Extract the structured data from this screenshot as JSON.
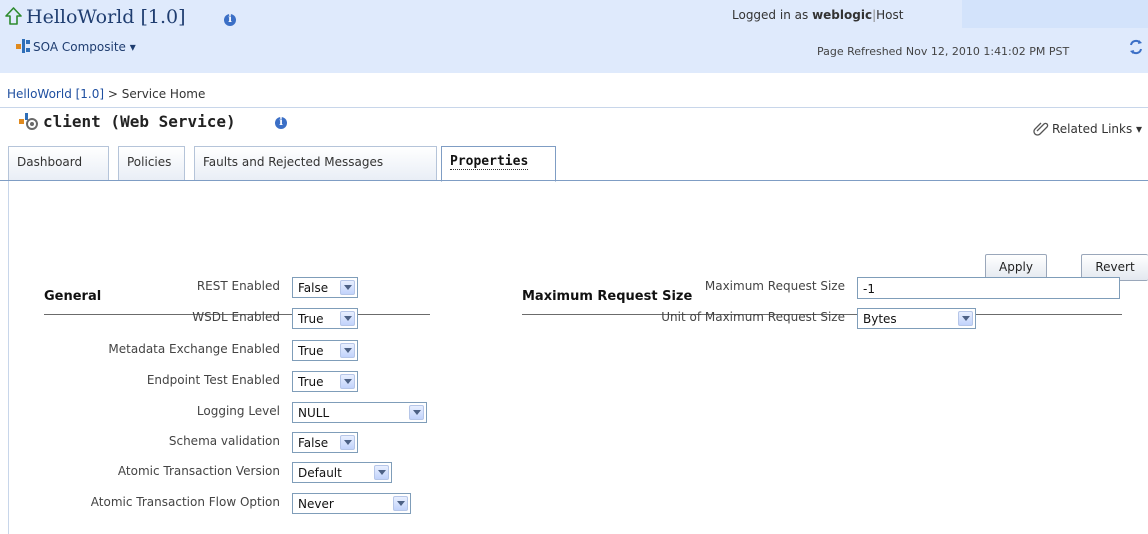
{
  "header": {
    "title": "HelloWorld [1.0]",
    "composite_menu": "SOA Composite ▾",
    "logged_in_prefix": "Logged in as",
    "user": "weblogic",
    "separator": "|",
    "host": "Host",
    "page_refreshed": "Page Refreshed Nov 12, 2010 1:41:02 PM PST"
  },
  "breadcrumb": {
    "link": "HelloWorld [1.0]",
    "separator": " > ",
    "current": "Service Home"
  },
  "service": {
    "title": "client (Web Service)",
    "related_links": "Related Links ▾"
  },
  "tabs": [
    {
      "label": "Dashboard",
      "active": false
    },
    {
      "label": "Policies",
      "active": false
    },
    {
      "label": "Faults and Rejected Messages",
      "active": false
    },
    {
      "label": "Properties",
      "active": true
    }
  ],
  "buttons": {
    "apply": "Apply",
    "revert": "Revert"
  },
  "general": {
    "title": "General",
    "rows": [
      {
        "label": "REST Enabled",
        "value": "False"
      },
      {
        "label": "WSDL Enabled",
        "value": "True"
      },
      {
        "label": "Metadata Exchange Enabled",
        "value": "True"
      },
      {
        "label": "Endpoint Test Enabled",
        "value": "True"
      },
      {
        "label": "Logging Level",
        "value": "NULL"
      },
      {
        "label": "Schema validation",
        "value": "False"
      },
      {
        "label": "Atomic Transaction Version",
        "value": "Default"
      },
      {
        "label": "Atomic Transaction Flow Option",
        "value": "Never"
      }
    ]
  },
  "max_request": {
    "title": "Maximum Request Size",
    "size_label": "Maximum Request Size",
    "size_value": "-1",
    "unit_label": "Unit of Maximum Request Size",
    "unit_value": "Bytes"
  },
  "colors": {
    "header_bg": "#dfeafc",
    "link": "#1f4fa0",
    "title": "#1f3d70"
  }
}
